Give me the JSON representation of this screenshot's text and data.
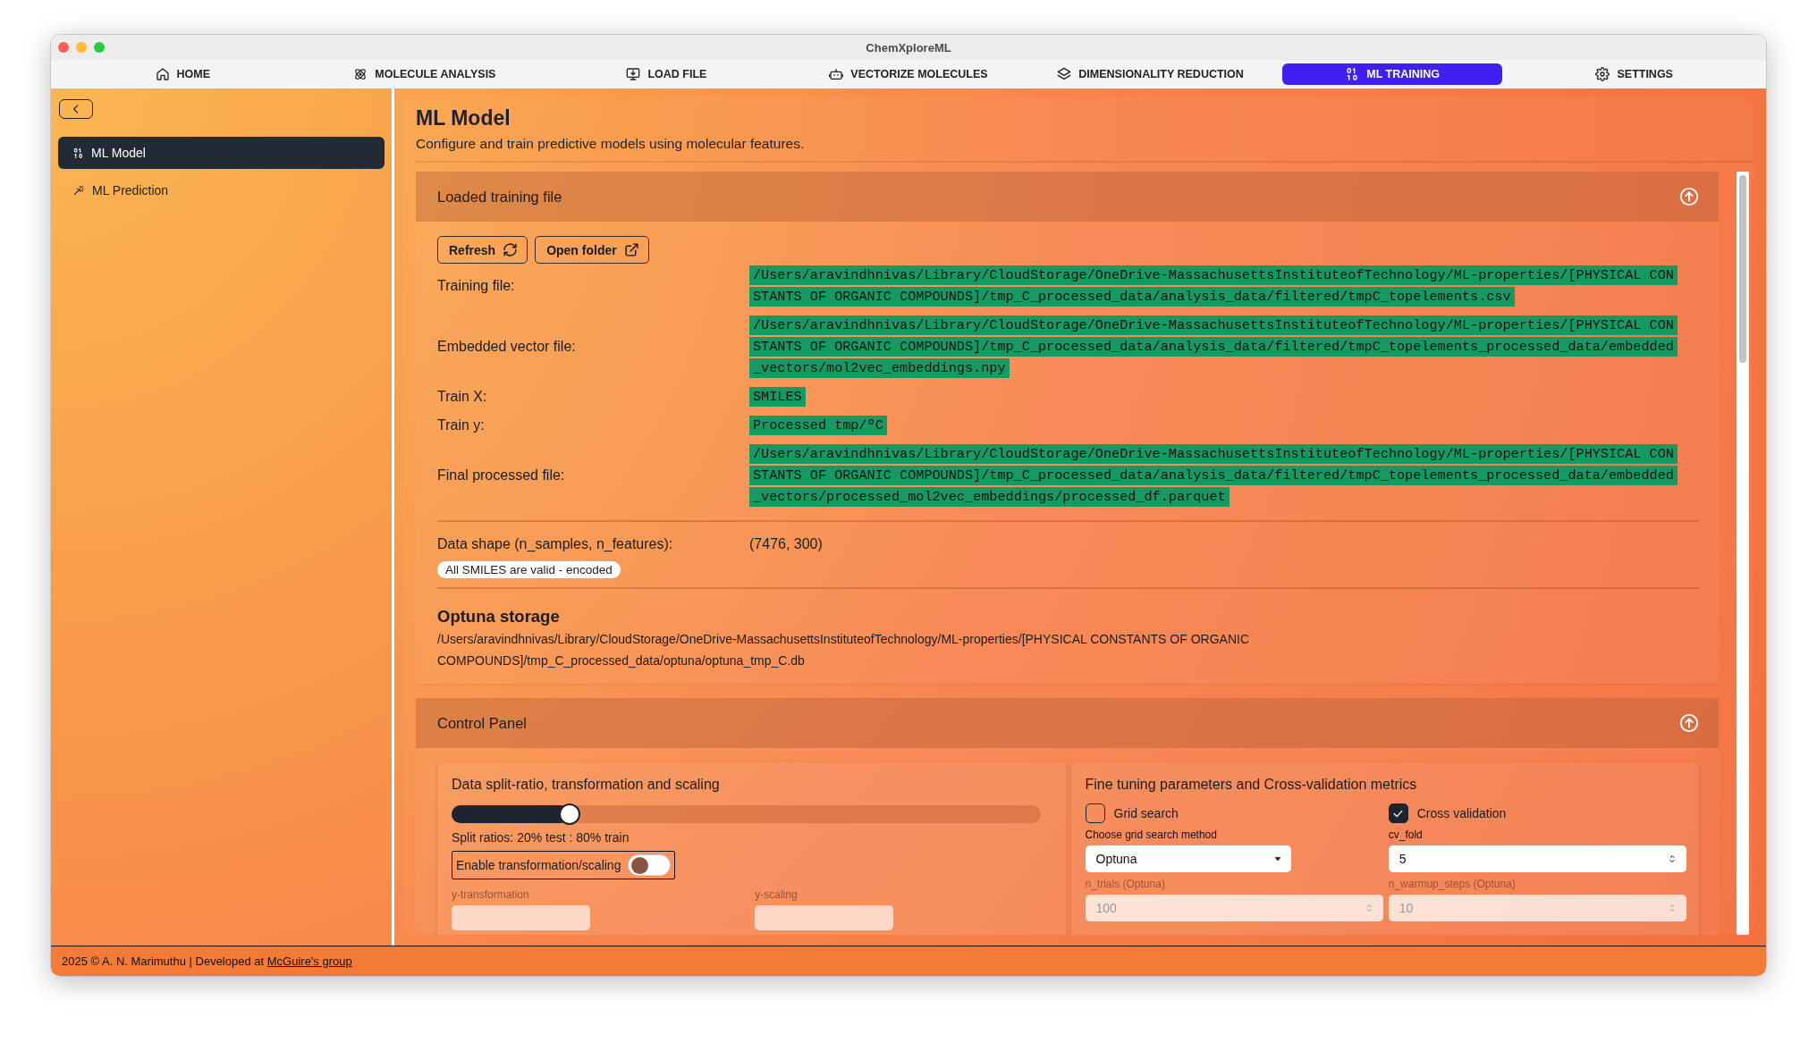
{
  "window": {
    "title": "ChemXploreML"
  },
  "nav_tabs": [
    {
      "label": "HOME",
      "selected": false
    },
    {
      "label": "MOLECULE ANALYSIS",
      "selected": false
    },
    {
      "label": "LOAD FILE",
      "selected": false
    },
    {
      "label": "VECTORIZE MOLECULES",
      "selected": false
    },
    {
      "label": "DIMENSIONALITY REDUCTION",
      "selected": false
    },
    {
      "label": "ML TRAINING",
      "selected": true
    },
    {
      "label": "SETTINGS",
      "selected": false
    }
  ],
  "sidebar": {
    "items": [
      {
        "label": "ML Model",
        "selected": true
      },
      {
        "label": "ML Prediction",
        "selected": false
      }
    ]
  },
  "page": {
    "title": "ML Model",
    "subtitle": "Configure and train predictive models using molecular features."
  },
  "loaded_file_panel": {
    "title": "Loaded training file",
    "expanded": true,
    "buttons": [
      "Refresh",
      "Open folder"
    ],
    "fields": [
      {
        "label": "Training file:",
        "value": "/Users/aravindhnivas/Library/CloudStorage/OneDrive-MassachusettsInstituteofTechnology/ML-properties/[PHYSICAL CONSTANTS OF ORGANIC COMPOUNDS]/tmp_C_processed_data/analysis_data/filtered/tmpC_topelements.csv"
      },
      {
        "label": "Embedded vector file:",
        "value": "/Users/aravindhnivas/Library/CloudStorage/OneDrive-MassachusettsInstituteofTechnology/ML-properties/[PHYSICAL CONSTANTS OF ORGANIC COMPOUNDS]/tmp_C_processed_data/analysis_data/filtered/tmpC_topelements_processed_data/embedded_vectors/mol2vec_embeddings.npy"
      },
      {
        "label": "Train X:",
        "value": "SMILES"
      },
      {
        "label": "Train y:",
        "value": "Processed tmp/ºC"
      },
      {
        "label": "Final processed file:",
        "value": "/Users/aravindhnivas/Library/CloudStorage/OneDrive-MassachusettsInstituteofTechnology/ML-properties/[PHYSICAL CONSTANTS OF ORGANIC COMPOUNDS]/tmp_C_processed_data/analysis_data/filtered/tmpC_topelements_processed_data/embedded_vectors/processed_mol2vec_embeddings/processed_df.parquet"
      }
    ],
    "data_shape": {
      "label": "Data shape (n_samples, n_features):",
      "value": "(7476, 300)"
    },
    "badge": "All SMILES are valid - encoded",
    "optuna_storage": {
      "title": "Optuna storage",
      "path": "/Users/aravindhnivas/Library/CloudStorage/OneDrive-MassachusettsInstituteofTechnology/ML-properties/[PHYSICAL CONSTANTS OF ORGANIC COMPOUNDS]/tmp_C_processed_data/optuna/optuna_tmp_C.db"
    }
  },
  "control_panel": {
    "title": "Control Panel",
    "expanded": true,
    "split_card": {
      "title": "Data split-ratio, transformation and scaling",
      "slider": {
        "level": 0.2
      },
      "split_text": "Split ratios: 20% test : 80% train",
      "toggle": {
        "label": "Enable transformation/scaling",
        "on": false
      },
      "fields": [
        {
          "label": "y-transformation"
        },
        {
          "label": "y-scaling"
        }
      ]
    },
    "tuning_card": {
      "title": "Fine tuning parameters and Cross-validation metrics",
      "checkboxes": [
        {
          "label": "Grid search",
          "checked": false
        },
        {
          "label": "Cross validation",
          "checked": true
        }
      ],
      "fields": [
        {
          "label": "Choose grid search method",
          "value": "Optuna",
          "kind": "select",
          "disabled": false
        },
        {
          "label": "cv_fold",
          "value": "5",
          "kind": "number",
          "disabled": false
        },
        {
          "label": "n_trials (Optuna)",
          "value": "100",
          "kind": "number",
          "disabled": true
        },
        {
          "label": "n_warmup_steps (Optuna)",
          "value": "10",
          "kind": "number",
          "disabled": true
        }
      ]
    }
  },
  "footer": {
    "text": "2025 © A. N. Marimuthu | Developed at ",
    "link": "McGuire's group"
  }
}
